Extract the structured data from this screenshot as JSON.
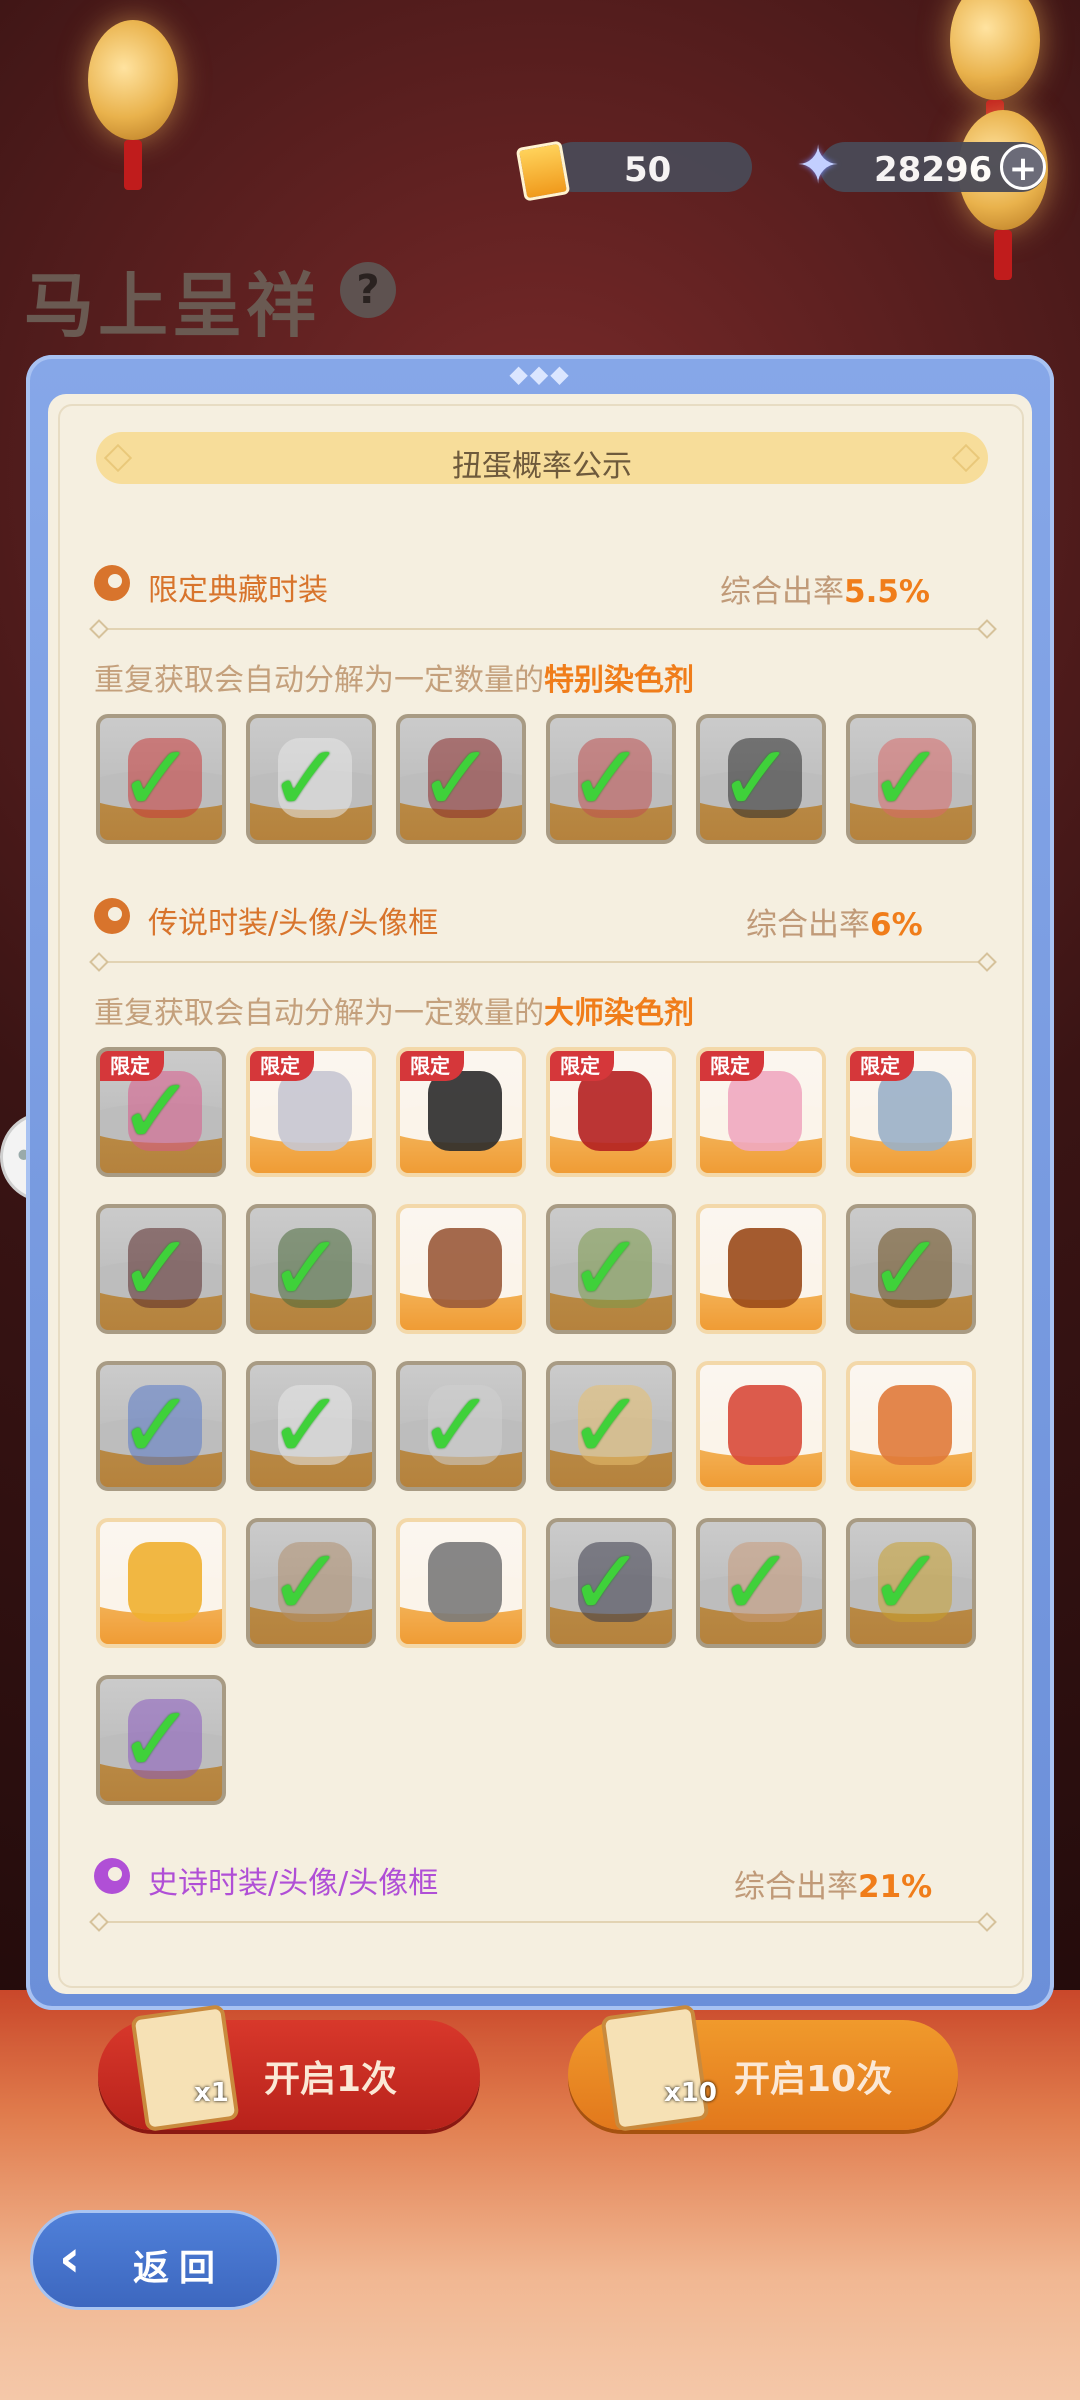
{
  "currency": {
    "tickets": "50",
    "stars": "28296",
    "plus": "+"
  },
  "page": {
    "title": "马上呈祥",
    "help": "?"
  },
  "modal": {
    "title": "扭蛋概率公示",
    "sections": [
      {
        "name": "限定典藏时装",
        "rate_label": "综合出率",
        "rate_value": "5.5%",
        "note_prefix": "重复获取会自动分解为一定数量的",
        "note_highlight": "特别染色剂",
        "color": "#d8742c"
      },
      {
        "name": "传说时装/头像/头像框",
        "rate_label": "综合出率",
        "rate_value": "6%",
        "note_prefix": "重复获取会自动分解为一定数量的",
        "note_highlight": "大师染色剂",
        "color": "#d8742c"
      },
      {
        "name": "史诗时装/头像/头像框",
        "rate_label": "综合出率",
        "rate_value": "21%",
        "color": "#b04fd6"
      }
    ],
    "limited_tag": "限定",
    "check_mark": "✓"
  },
  "items_special": [
    {
      "owned": true,
      "limited": false,
      "art": "#c83a3a",
      "icon": "sword-item"
    },
    {
      "owned": true,
      "limited": false,
      "art": "#e8e8e8",
      "icon": "white-hair-item"
    },
    {
      "owned": true,
      "limited": false,
      "art": "#8a2a2a",
      "icon": "ornament-item"
    },
    {
      "owned": true,
      "limited": false,
      "art": "#c05050",
      "icon": "costume-item"
    },
    {
      "owned": true,
      "limited": false,
      "art": "#2a2a2a",
      "icon": "black-hair-item"
    },
    {
      "owned": true,
      "limited": false,
      "art": "#d86a6a",
      "icon": "accessory-item"
    }
  ],
  "items_legend": [
    {
      "owned": true,
      "limited": true,
      "art": "#d85a8a",
      "icon": "pink-hair-item"
    },
    {
      "owned": false,
      "limited": true,
      "art": "#c7c7d2",
      "icon": "star-clip-item"
    },
    {
      "owned": false,
      "limited": true,
      "art": "#2b2b2b",
      "icon": "dark-hair-item"
    },
    {
      "owned": false,
      "limited": true,
      "art": "#b42020",
      "icon": "glasses-item"
    },
    {
      "owned": false,
      "limited": true,
      "art": "#f0a8c0",
      "icon": "heart-pins-item"
    },
    {
      "owned": false,
      "limited": true,
      "art": "#9ab0c8",
      "icon": "outfit-item"
    },
    {
      "owned": true,
      "limited": false,
      "art": "#5a2a2a",
      "icon": "spear-item"
    },
    {
      "owned": true,
      "limited": false,
      "art": "#4a6a3a",
      "icon": "green-spear-item"
    },
    {
      "owned": false,
      "limited": false,
      "art": "#9a5a3a",
      "icon": "brown-hair-item"
    },
    {
      "owned": true,
      "limited": false,
      "art": "#7c9a4a",
      "icon": "green-braid-item"
    },
    {
      "owned": false,
      "limited": false,
      "art": "#9a4a1a",
      "icon": "violin-item"
    },
    {
      "owned": true,
      "limited": false,
      "art": "#6a4a1a",
      "icon": "cannon-item"
    },
    {
      "owned": true,
      "limited": false,
      "art": "#5a7ac8",
      "icon": "bow-item"
    },
    {
      "owned": true,
      "limited": false,
      "art": "#e8e8e8",
      "icon": "cat-hat-item"
    },
    {
      "owned": true,
      "limited": false,
      "art": "#d0d0d0",
      "icon": "pale-item"
    },
    {
      "owned": true,
      "limited": false,
      "art": "#e8c070",
      "icon": "sparkle-item"
    },
    {
      "owned": false,
      "limited": false,
      "art": "#d84a3a",
      "icon": "red-monster-avatar"
    },
    {
      "owned": false,
      "limited": false,
      "art": "#e07a3a",
      "icon": "tiger-avatar"
    },
    {
      "owned": false,
      "limited": false,
      "art": "#f0b030",
      "icon": "fox-gold-avatar"
    },
    {
      "owned": true,
      "limited": false,
      "art": "#b09070",
      "icon": "girl-avatar"
    },
    {
      "owned": false,
      "limited": false,
      "art": "#7a7a7a",
      "icon": "burst-frame"
    },
    {
      "owned": true,
      "limited": false,
      "art": "#3a3a4a",
      "icon": "cage-frame"
    },
    {
      "owned": true,
      "limited": false,
      "art": "#c89a7a",
      "icon": "hello-frame"
    },
    {
      "owned": true,
      "limited": false,
      "art": "#c8a030",
      "icon": "gold-ring-frame"
    },
    {
      "owned": true,
      "limited": false,
      "art": "#8a5ac0",
      "icon": "purple-frame"
    }
  ],
  "buttons": {
    "open_one": "开启1次",
    "open_one_mult": "x1",
    "open_ten": "开启10次",
    "open_ten_mult": "x10",
    "back": "返回"
  },
  "colors": {
    "rate_value": "#f07d1a",
    "owned_check": "#3fd13a",
    "limited_tag": "#d5373a"
  }
}
